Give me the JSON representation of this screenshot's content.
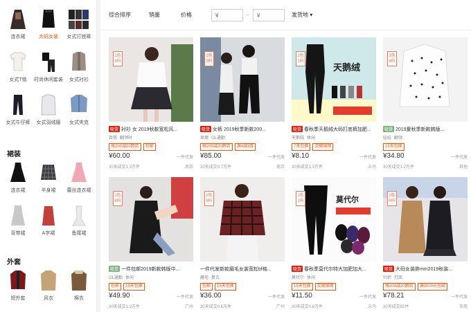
{
  "sidebar": {
    "row1": [
      {
        "label": "连衣裙",
        "active": false
      },
      {
        "label": "大码女装",
        "active": true
      },
      {
        "label": "女式打底裤",
        "active": false
      }
    ],
    "row2": [
      {
        "label": "女式T恤"
      },
      {
        "label": "时尚休闲套装"
      },
      {
        "label": "女式衬衫"
      }
    ],
    "row3": [
      {
        "label": "女式牛仔裤"
      },
      {
        "label": "女式羽绒服"
      },
      {
        "label": "女式夹克"
      }
    ],
    "section2": "裙装",
    "row4": [
      {
        "label": "连衣裙"
      },
      {
        "label": "半身裙"
      },
      {
        "label": "蕾丝连衣裙"
      }
    ],
    "row5": [
      {
        "label": "背带裙"
      },
      {
        "label": "A字裙"
      },
      {
        "label": "鱼尾裙"
      }
    ],
    "section3": "外套",
    "row6": [
      {
        "label": "短外套"
      },
      {
        "label": "风衣"
      },
      {
        "label": "棉衣"
      }
    ]
  },
  "filter": {
    "sort": "综合排序",
    "sales": "销量",
    "price": "价格",
    "price_min": "¥",
    "price_max": "¥",
    "dash": "–",
    "ship": "发货地 ▾"
  },
  "products": [
    {
      "badge": "吸货",
      "badge_color": "red",
      "title": "衬衫 女 2019秋款宽松风...",
      "tags": [
        "百搭",
        "翻领衬"
      ],
      "promos": [
        "每200减20跨店",
        "包邮"
      ],
      "price": "¥60.00",
      "dropship": "一件代发",
      "sold": "30天成交1.3万件",
      "loc": "南京",
      "side": "2色6码"
    },
    {
      "badge": "吸货",
      "badge_color": "red",
      "title": "女裤 2019秋季新款200...",
      "tags": [
        "显瘦",
        "OL通勤"
      ],
      "promos": [
        "每200减20跨店",
        "满4减3券"
      ],
      "price": "¥85.00",
      "dropship": "一件代发",
      "sold": "30天成交0.7万件",
      "loc": "南京",
      "side": "1色5码"
    },
    {
      "badge": "吸货",
      "badge_color": "red",
      "title": "春秋季天鹅绒大码打底裤加肥...",
      "tags": [
        "天鹅绒",
        "休闲"
      ],
      "promos": [
        "7天包换",
        "交期保障"
      ],
      "price": "¥8.10",
      "dropship": "一件代发",
      "sold": "30天成交1.3万件",
      "loc": "义乌",
      "side": "2色1码",
      "banner": "天鹅绒"
    },
    {
      "badge": "吸货",
      "badge_color": "green",
      "title": "2019夏秋季新款韩版...",
      "tags": [
        "娃娃",
        "翻领"
      ],
      "promos": [
        "15天包换"
      ],
      "price": "¥34.80",
      "dropship": "一件代发",
      "sold": "30天成交1.2万件",
      "loc": "其他",
      "side": "3色6码"
    },
    {
      "badge": "吸货",
      "badge_color": "green",
      "title": "一件包邮2019新款韩版中...",
      "tags": [
        "OL通勤",
        "休闲"
      ],
      "promos": [
        "包邮",
        "15天包换"
      ],
      "price": "¥49.90",
      "dropship": "一件代发",
      "sold": "30天成交1.2万件",
      "loc": "广州",
      "side": "2色6码"
    },
    {
      "badge": "",
      "badge_color": "",
      "title": "一件代发新款磨毛女装宽松bf格...",
      "tags": [
        "磨毛",
        "复古"
      ],
      "promos": [
        "包邮",
        "15天包换"
      ],
      "price": "¥36.00",
      "dropship": "一件代发",
      "sold": "30天成交0.6万件",
      "loc": "广州",
      "side": "2色6码"
    },
    {
      "badge": "吸货",
      "badge_color": "red",
      "title": "春秋季莫代尔特大加肥加大...",
      "tags": [
        "莫代尔",
        "休闲"
      ],
      "promos": [
        "15天包换",
        "交期保障"
      ],
      "price": "¥11.50",
      "dropship": "一件代发",
      "sold": "30天成交0.6万件",
      "loc": "义乌",
      "side": "2色1码",
      "banner": "莫代尔"
    },
    {
      "badge": "吸货",
      "badge_color": "red",
      "title": "大码女装胖mm2019秋装...",
      "tags": [
        "针织",
        "打底"
      ],
      "promos": [
        "每200减20跨店",
        "满3000元包邮"
      ],
      "price": "¥78.21",
      "dropship": "一件代发",
      "sold": "30天成交82件",
      "loc": "东莞",
      "side": "2色6码"
    }
  ]
}
